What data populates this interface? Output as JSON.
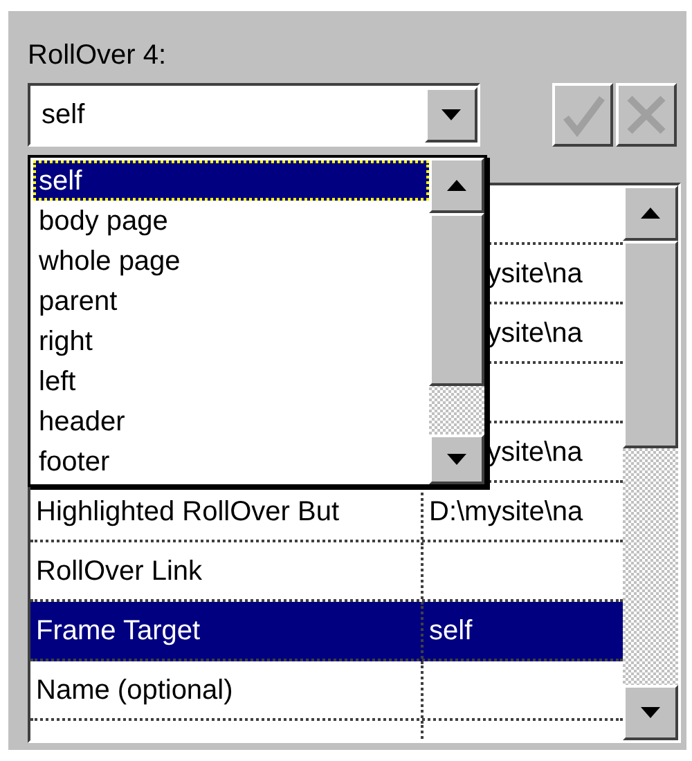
{
  "label": "RollOver 4:",
  "combo": {
    "value": "self",
    "expanded": true
  },
  "buttons": [
    {
      "kind": "check",
      "disabled": true
    },
    {
      "kind": "cross",
      "disabled": true
    }
  ],
  "dropdown_options": [
    {
      "text": "self",
      "selected": true
    },
    {
      "text": "body page",
      "selected": false
    },
    {
      "text": "whole page",
      "selected": false
    },
    {
      "text": "parent",
      "selected": false
    },
    {
      "text": "right",
      "selected": false
    },
    {
      "text": "left",
      "selected": false
    },
    {
      "text": "header",
      "selected": false
    },
    {
      "text": "footer",
      "selected": false
    }
  ],
  "grid": {
    "rows": [
      {
        "selected": false
      },
      {
        "value": "ysite\\na",
        "selected": false
      },
      {
        "value": "ysite\\na",
        "selected": false
      },
      {
        "selected": false
      },
      {
        "value": "ysite\\na",
        "selected": false
      },
      {
        "label": "Highlighted RollOver But",
        "value": "D:\\mysite\\na",
        "selected": false
      },
      {
        "label": "RollOver Link",
        "selected": false
      },
      {
        "label": "Frame Target",
        "value": "self",
        "selected": true
      },
      {
        "label": "Name (optional)",
        "selected": false
      },
      {
        "selected": false
      }
    ]
  }
}
